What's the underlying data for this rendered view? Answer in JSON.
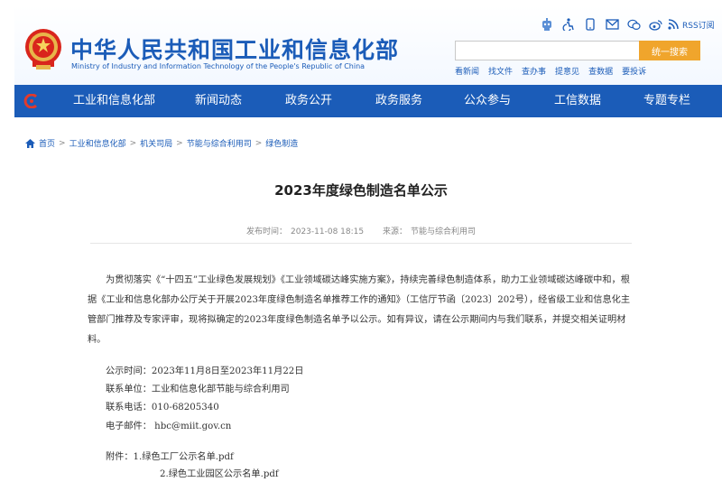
{
  "header": {
    "title_cn": "中华人民共和国工业和信息化部",
    "title_en": "Ministry of Industry and Information Technology of the People's Republic of China",
    "rss_label": "RSS订阅",
    "search_button": "统一搜索",
    "search_placeholder": "",
    "quick_links": [
      "看新闻",
      "找文件",
      "查办事",
      "提意见",
      "查数据",
      "要投诉"
    ]
  },
  "nav": {
    "items": [
      "工业和信息化部",
      "新闻动态",
      "政务公开",
      "政务服务",
      "公众参与",
      "工信数据",
      "专题专栏"
    ]
  },
  "breadcrumb": [
    "首页",
    "工业和信息化部",
    "机关司局",
    "节能与综合利用司",
    "绿色制造"
  ],
  "article": {
    "title": "2023年度绿色制造名单公示",
    "publish_label": "发布时间：",
    "publish_time": "2023-11-08 18:15",
    "source_label": "来源：",
    "source": "节能与综合利用司",
    "paragraph": "为贯彻落实《“十四五”工业绿色发展规划》《工业领域碳达峰实施方案》，持续完善绿色制造体系，助力工业领域碳达峰碳中和，根据《工业和信息化部办公厅关于开展2023年度绿色制造名单推荐工作的通知》（工信厅节函〔2023〕202号），经省级工业和信息化主管部门推荐及专家评审，现将拟确定的2023年度绿色制造名单予以公示。如有异议，请在公示期间内与我们联系，并提交相关证明材料。",
    "period": "公示时间：2023年11月8日至2023年11月22日",
    "unit": "联系单位：工业和信息化部节能与综合利用司",
    "phone": "联系电话：010-68205340",
    "email": "电子邮件： hbc@miit.gov.cn",
    "attachment_1": "附件：1.绿色工厂公示名单.pdf",
    "attachment_2": "2.绿色工业园区公示名单.pdf"
  },
  "colors": {
    "brand_blue": "#1b5cb8",
    "search_orange": "#f0a52c"
  }
}
